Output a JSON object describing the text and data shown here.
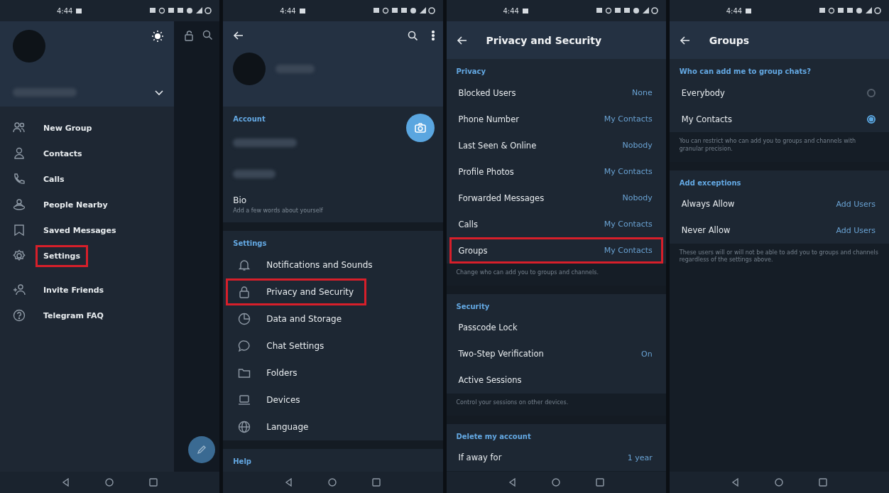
{
  "screens": [
    {
      "kind": "drawer",
      "time": "4:44",
      "menu": [
        {
          "label": "New Group",
          "highlighted": false
        },
        {
          "label": "Contacts",
          "highlighted": false
        },
        {
          "label": "Calls",
          "highlighted": false
        },
        {
          "label": "People Nearby",
          "highlighted": false
        },
        {
          "label": "Saved Messages",
          "highlighted": false
        },
        {
          "label": "Settings",
          "highlighted": true
        },
        {
          "label": "Invite Friends",
          "highlighted": false
        },
        {
          "label": "Telegram FAQ",
          "highlighted": false
        }
      ]
    },
    {
      "kind": "settings",
      "time": "4:44",
      "account_header": "Account",
      "bio": {
        "label": "Bio",
        "hint": "Add a few words about yourself"
      },
      "settings_header": "Settings",
      "items": [
        {
          "label": "Notifications and Sounds",
          "highlighted": false
        },
        {
          "label": "Privacy and Security",
          "highlighted": true
        },
        {
          "label": "Data and Storage",
          "highlighted": false
        },
        {
          "label": "Chat Settings",
          "highlighted": false
        },
        {
          "label": "Folders",
          "highlighted": false
        },
        {
          "label": "Devices",
          "highlighted": false
        },
        {
          "label": "Language",
          "highlighted": false
        }
      ],
      "help_header": "Help"
    },
    {
      "kind": "list",
      "time": "4:44",
      "title": "Privacy and Security",
      "sections": [
        {
          "header": "Privacy",
          "rows": [
            {
              "kind": "value",
              "label": "Blocked Users",
              "value": "None",
              "highlighted": false
            },
            {
              "kind": "value",
              "label": "Phone Number",
              "value": "My Contacts",
              "highlighted": false
            },
            {
              "kind": "value",
              "label": "Last Seen & Online",
              "value": "Nobody",
              "highlighted": false
            },
            {
              "kind": "value",
              "label": "Profile Photos",
              "value": "My Contacts",
              "highlighted": false
            },
            {
              "kind": "value",
              "label": "Forwarded Messages",
              "value": "Nobody",
              "highlighted": false
            },
            {
              "kind": "value",
              "label": "Calls",
              "value": "My Contacts",
              "highlighted": false
            },
            {
              "kind": "value",
              "label": "Groups",
              "value": "My Contacts",
              "highlighted": true
            }
          ],
          "hint": "Change who can add you to groups and channels."
        },
        {
          "header": "Security",
          "rows": [
            {
              "kind": "value",
              "label": "Passcode Lock",
              "highlighted": false
            },
            {
              "kind": "value",
              "label": "Two-Step Verification",
              "value": "On",
              "highlighted": false
            },
            {
              "kind": "value",
              "label": "Active Sessions",
              "highlighted": false
            }
          ],
          "hint": "Control your sessions on other devices."
        },
        {
          "header": "Delete my account",
          "rows": [
            {
              "kind": "value",
              "label": "If away for",
              "value": "1 year",
              "highlighted": false
            }
          ]
        }
      ]
    },
    {
      "kind": "list",
      "time": "4:44",
      "title": "Groups",
      "sections": [
        {
          "header": "Who can add me to group chats?",
          "rows": [
            {
              "kind": "radio",
              "label": "Everybody",
              "selected": false
            },
            {
              "kind": "radio",
              "label": "My Contacts",
              "selected": true
            }
          ],
          "hint": "You can restrict who can add you to groups and channels with granular precision."
        },
        {
          "header": "Add exceptions",
          "rows": [
            {
              "kind": "value",
              "label": "Always Allow",
              "value": "Add Users",
              "highlighted": false
            },
            {
              "kind": "value",
              "label": "Never Allow",
              "value": "Add Users",
              "highlighted": false
            }
          ],
          "hint": "These users will or will not be able to add you to groups and channels regardless of the settings above."
        }
      ]
    }
  ]
}
